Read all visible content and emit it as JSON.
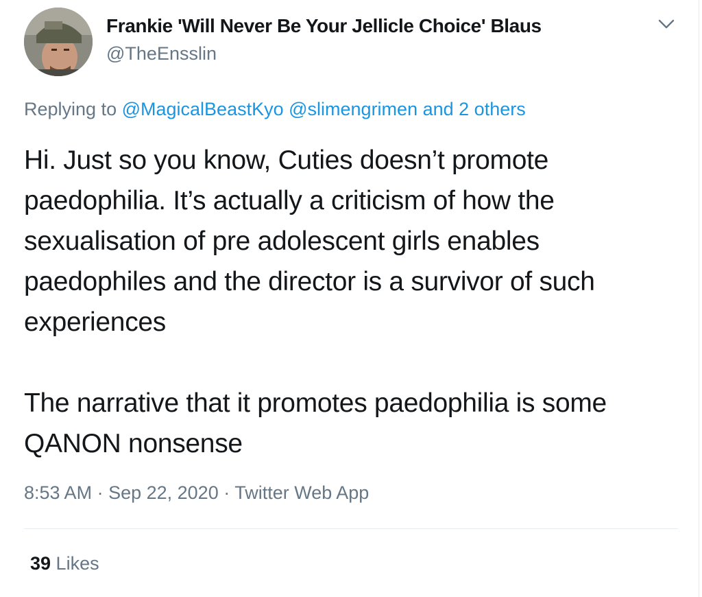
{
  "author": {
    "display_name": "Frankie 'Will Never Be Your Jellicle Choice' Blaus",
    "handle": "@TheEnsslin",
    "avatar_icon": "user-avatar-photo"
  },
  "menu": {
    "icon": "chevron-down-icon"
  },
  "reply": {
    "prefix": "Replying to ",
    "mentions": [
      "@MagicalBeastKyo",
      "@slimengrimen"
    ],
    "others": "and 2 others"
  },
  "body": {
    "paragraph1": "Hi. Just so you know, Cuties doesn’t promote paedophilia. It’s actually a criticism of how the sexualisation of pre adolescent girls enables paedophiles and the director is a survivor of such experiences",
    "paragraph2": "The narrative that it promotes paedophilia is some QANON nonsense"
  },
  "meta": {
    "time": "8:53 AM",
    "separator": " · ",
    "date": "Sep 22, 2020",
    "source": "Twitter Web App"
  },
  "stats": {
    "likes_count": "39",
    "likes_label": " Likes"
  },
  "colors": {
    "text": "#14171a",
    "secondary": "#657786",
    "link": "#1b95e0",
    "divider": "#e6ecf0"
  }
}
